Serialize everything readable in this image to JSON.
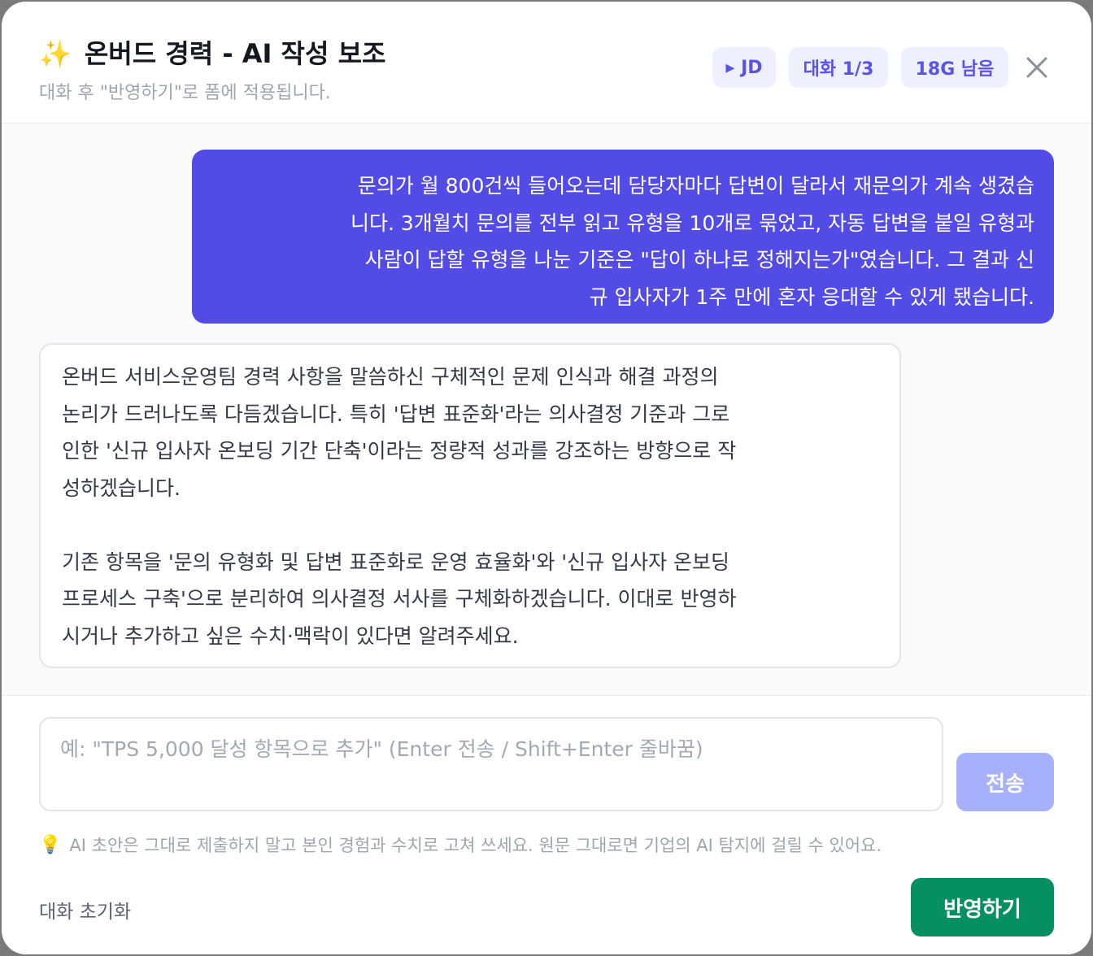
{
  "header": {
    "icon": "sparkles-icon",
    "icon_glyph": "✨",
    "title": "온버드 경력 - AI 작성 보조",
    "subtitle": "대화 후 \"반영하기\"로 폼에 적용됩니다.",
    "chips": {
      "jd": "▸ JD",
      "turn": "대화 1/3",
      "remaining": "18G 남음"
    },
    "close_icon": "close-icon"
  },
  "chat": {
    "user_message": "문의가 월 800건씩 들어오는데 담당자마다 답변이 달라서 재문의가 계속 생겼습\n니다. 3개월치 문의를 전부 읽고 유형을 10개로 묶었고, 자동 답변을 붙일 유형과\n사람이 답할 유형을 나눈 기준은 \"답이 하나로 정해지는가\"였습니다. 그 결과 신\n규 입사자가 1주 만에 혼자 응대할 수 있게 됐습니다.",
    "ai_message": "온버드 서비스운영팀 경력 사항을 말씀하신 구체적인 문제 인식과 해결 과정의\n논리가 드러나도록 다듬겠습니다. 특히 '답변 표준화'라는 의사결정 기준과 그로\n인한 '신규 입사자 온보딩 기간 단축'이라는 정량적 성과를 강조하는 방향으로 작\n성하겠습니다.\n\n기존 항목을 '문의 유형화 및 답변 표준화로 운영 효율화'와 '신규 입사자 온보딩\n프로세스 구축'으로 분리하여 의사결정 서사를 구체화하겠습니다. 이대로 반영하\n시거나 추가하고 싶은 수치·맥락이 있다면 알려주세요."
  },
  "composer": {
    "value": "",
    "placeholder": "예: \"TPS 5,000 달성 항목으로 추가\" (Enter 전송 / Shift+Enter 줄바꿈)",
    "send_label": "전송"
  },
  "notice": {
    "icon": "lightbulb-icon",
    "icon_glyph": "💡",
    "text": "AI 초안은 그대로 제출하지 말고 본인 경험과 수치로 고쳐 쓰세요. 원문 그대로면 기업의 AI 탐지에 걸릴 수 있어요."
  },
  "actions": {
    "reset_label": "대화 초기화",
    "apply_label": "반영하기"
  },
  "colors": {
    "accent": "#534be6",
    "chip_bg": "#eef0ff",
    "send_disabled": "#a7b1fb",
    "apply": "#069062"
  }
}
